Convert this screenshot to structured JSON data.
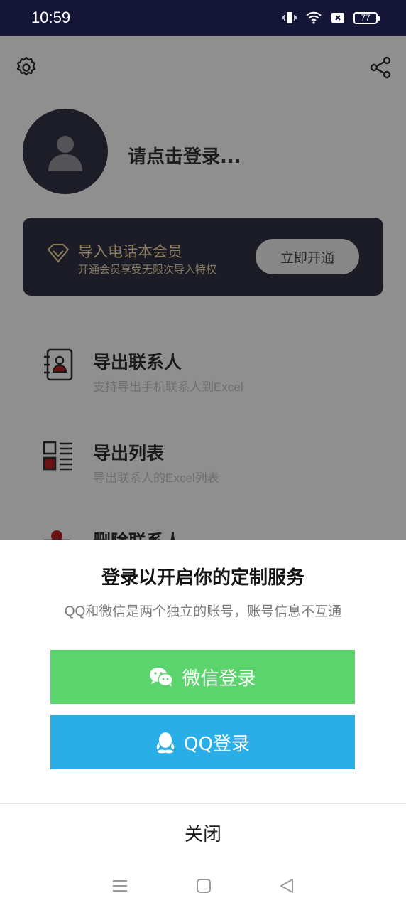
{
  "status_bar": {
    "time": "10:59",
    "battery": "77"
  },
  "profile": {
    "login_prompt": "请点击登录..."
  },
  "vip": {
    "title": "导入电话本会员",
    "subtitle": "开通会员享受无限次导入特权",
    "button": "立即开通"
  },
  "menu": [
    {
      "title": "导出联系人",
      "desc": "支持导出手机联系人到Excel"
    },
    {
      "title": "导出列表",
      "desc": "导出联系人的Excel列表"
    },
    {
      "title": "删除联系人"
    }
  ],
  "login_sheet": {
    "title": "登录以开启你的定制服务",
    "subtitle": "QQ和微信是两个独立的账号，账号信息不互通",
    "wechat_label": "微信登录",
    "qq_label": "QQ登录",
    "close_label": "关闭"
  },
  "colors": {
    "wechat": "#5bd46d",
    "qq": "#2aaee8",
    "status_bar": "#151537"
  }
}
